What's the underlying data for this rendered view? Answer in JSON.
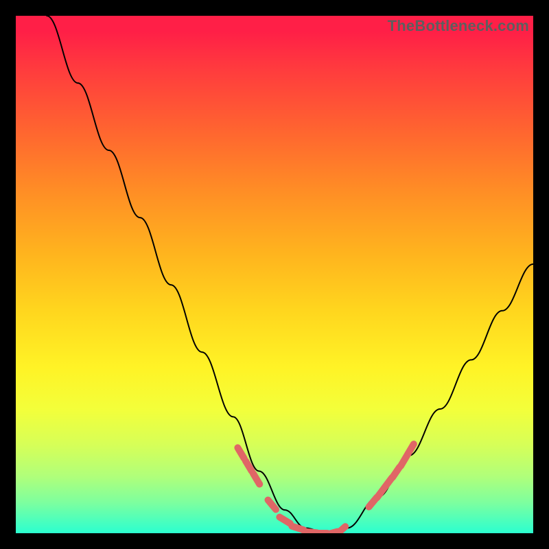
{
  "watermark": "TheBottleneck.com",
  "gradient": {
    "direction": "vertical",
    "stops": [
      {
        "offset": 0.0,
        "color": "#ff1f47"
      },
      {
        "offset": 0.03,
        "color": "#ff1f47"
      },
      {
        "offset": 0.1,
        "color": "#ff3a3e"
      },
      {
        "offset": 0.22,
        "color": "#ff6430"
      },
      {
        "offset": 0.34,
        "color": "#ff8e25"
      },
      {
        "offset": 0.46,
        "color": "#ffb41e"
      },
      {
        "offset": 0.57,
        "color": "#ffd61e"
      },
      {
        "offset": 0.68,
        "color": "#fff326"
      },
      {
        "offset": 0.76,
        "color": "#f3ff3a"
      },
      {
        "offset": 0.83,
        "color": "#d6ff58"
      },
      {
        "offset": 0.89,
        "color": "#b0ff7a"
      },
      {
        "offset": 0.94,
        "color": "#7eff9e"
      },
      {
        "offset": 0.98,
        "color": "#46ffc0"
      },
      {
        "offset": 1.0,
        "color": "#2bffcf"
      }
    ]
  },
  "chart_data": {
    "type": "line",
    "title": "",
    "xlabel": "",
    "ylabel": "",
    "xlim": [
      0,
      1
    ],
    "ylim": [
      0,
      1
    ],
    "note": "Axes are unlabeled; data points are normalized to the plot area (0=left/bottom, 1=right/top).",
    "series": [
      {
        "name": "black-curve",
        "color": "#000000",
        "x": [
          0.06,
          0.12,
          0.18,
          0.24,
          0.3,
          0.36,
          0.42,
          0.47,
          0.52,
          0.56,
          0.6,
          0.64,
          0.7,
          0.76,
          0.82,
          0.88,
          0.94,
          1.0
        ],
        "values": [
          1.0,
          0.87,
          0.74,
          0.61,
          0.48,
          0.35,
          0.225,
          0.12,
          0.045,
          0.01,
          0.0,
          0.01,
          0.07,
          0.15,
          0.24,
          0.335,
          0.43,
          0.52
        ]
      }
    ],
    "annotations": [
      {
        "name": "red-dash-cluster",
        "color": "#e06666",
        "shape": "short-dash",
        "x": [
          0.435,
          0.45,
          0.465,
          0.495,
          0.52,
          0.545,
          0.57,
          0.59,
          0.61,
          0.628,
          0.69,
          0.705,
          0.72,
          0.735,
          0.75,
          0.763
        ],
        "values": [
          0.155,
          0.13,
          0.105,
          0.055,
          0.025,
          0.01,
          0.002,
          0.0,
          0.0,
          0.005,
          0.06,
          0.078,
          0.098,
          0.118,
          0.14,
          0.162
        ]
      }
    ]
  }
}
